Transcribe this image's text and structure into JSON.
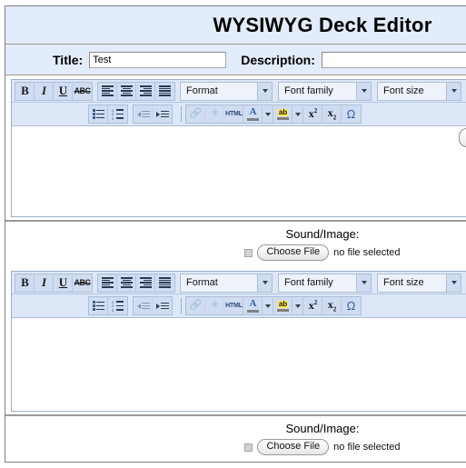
{
  "header": {
    "title": "WYSIWYG Deck Editor"
  },
  "meta": {
    "title_label": "Title:",
    "title_value": "Test",
    "title_placeholder": "",
    "description_label": "Description:",
    "description_value": "",
    "description_placeholder": ""
  },
  "toolbar": {
    "bold": "B",
    "italic": "I",
    "underline": "U",
    "strikethrough": "ABC",
    "align_left_icon": "align-left-icon",
    "align_center_icon": "align-center-icon",
    "align_right_icon": "align-right-icon",
    "align_justify_icon": "align-justify-icon",
    "format_label": "Format",
    "fontfamily_label": "Font family",
    "fontsize_label": "Font size",
    "bullist_icon": "bullet-list-icon",
    "numlist_icon": "numbered-list-icon",
    "outdent_icon": "outdent-icon",
    "indent_icon": "indent-icon",
    "link_icon": "link-icon",
    "unlink_icon": "unlink-icon",
    "html_label": "HTML",
    "forecolor_glyph": "A",
    "backcolor_glyph": "ab",
    "superscript": "x",
    "superscript_mark": "2",
    "subscript": "x",
    "subscript_mark": "2",
    "charmap_glyph": "Ω"
  },
  "editors": [
    {
      "id": "front",
      "content": ""
    },
    {
      "id": "back",
      "content": ""
    }
  ],
  "sound_image": [
    {
      "label": "Sound/Image:",
      "button_label": "Choose File",
      "status": "no file selected"
    },
    {
      "label": "Sound/Image:",
      "button_label": "Choose File",
      "status": "no file selected"
    }
  ],
  "colors": {
    "header_band": "#e3ecfa",
    "toolbar_bg": "#dde7f7",
    "toolbar_button_bg": "#cfdcf1",
    "toolbar_border": "#9ab0cd",
    "frame_border": "#808080",
    "canvas_bg": "#ffffff",
    "forecolor_swatch": "#2f5fa8",
    "backcolor_swatch": "#ffe94d"
  }
}
